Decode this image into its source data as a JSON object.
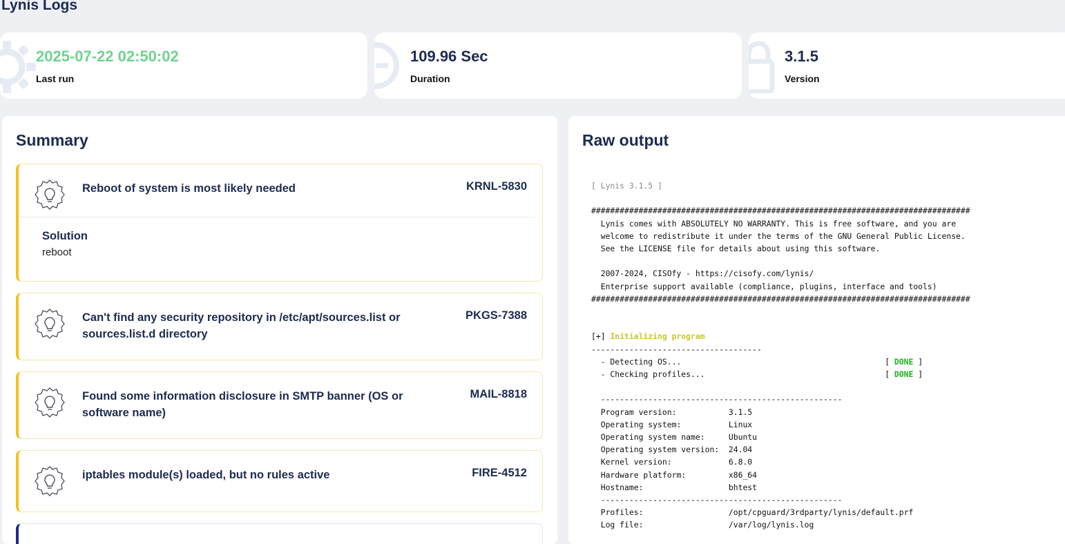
{
  "page": {
    "title": "Lynis Logs"
  },
  "stats": {
    "last_run": {
      "value": "2025-07-22 02:50:02",
      "label": "Last run",
      "icon": "gear-icon",
      "value_color": "#6fd390"
    },
    "duration": {
      "value": "109.96 Sec",
      "label": "Duration",
      "icon": "clock-icon"
    },
    "version": {
      "value": "3.1.5",
      "label": "Version",
      "icon": "lock-icon"
    }
  },
  "summary": {
    "title": "Summary",
    "items": [
      {
        "text": "Reboot of system is most likely needed",
        "code": "KRNL-5830",
        "solution_title": "Solution",
        "solution": "reboot",
        "icon": "lightbulb-icon"
      },
      {
        "text": "Can't find any security repository in /etc/apt/sources.list or sources.list.d directory",
        "code": "PKGS-7388",
        "icon": "lightbulb-icon"
      },
      {
        "text": "Found some information disclosure in SMTP banner (OS or software name)",
        "code": "MAIL-8818",
        "icon": "lightbulb-icon"
      },
      {
        "text": "iptables module(s) loaded, but no rules active",
        "code": "FIRE-4512",
        "icon": "lightbulb-icon"
      }
    ]
  },
  "raw": {
    "title": "Raw output",
    "header": "[ Lynis 3.1.5 ]",
    "banner": "################################################################################\n  Lynis comes with ABSOLUTELY NO WARRANTY. This is free software, and you are\n  welcome to redistribute it under the terms of the GNU General Public License.\n  See the LICENSE file for details about using this software.\n\n  2007-2024, CISOfy - https://cisofy.com/lynis/\n  Enterprise support available (compliance, plugins, interface and tools)\n################################################################################",
    "section_prefix": "[+] ",
    "section_title": "Initializing program",
    "section_rule": "------------------------------------",
    "check1": "  - Detecting OS...                                           ",
    "check2": "  - Checking profiles...                                      ",
    "bracket_open": "[ ",
    "done": "DONE",
    "bracket_close": " ]",
    "info": "  ---------------------------------------------------\n  Program version:           3.1.5\n  Operating system:          Linux\n  Operating system name:     Ubuntu\n  Operating system version:  24.04\n  Kernel version:            6.8.0\n  Hardware platform:         x86_64\n  Hostname:                  bhtest\n  ---------------------------------------------------\n  Profiles:                  /opt/cpguard/3rdparty/lynis/default.prf\n  Log file:                  /var/log/lynis.log"
  }
}
